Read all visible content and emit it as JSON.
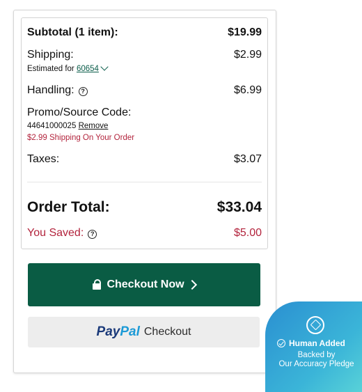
{
  "summary": {
    "subtotal_label": "Subtotal (1 item):",
    "subtotal_value": "$19.99",
    "shipping_label": "Shipping:",
    "shipping_value": "$2.99",
    "estimated_for_label": "Estimated for",
    "zip": "60654",
    "handling_label": "Handling:",
    "handling_value": "$6.99",
    "promo_label": "Promo/Source Code:",
    "promo_code": "44641000025",
    "promo_remove": "Remove",
    "promo_message": "$2.99 Shipping On Your Order",
    "taxes_label": "Taxes:",
    "taxes_value": "$3.07",
    "order_total_label": "Order Total:",
    "order_total_value": "$33.04",
    "saved_label": "You Saved:",
    "saved_value": "$5.00",
    "help_glyph": "?"
  },
  "checkout": {
    "label": "Checkout Now"
  },
  "paypal": {
    "brand_part1": "Pay",
    "brand_part2": "Pal",
    "label": "Checkout"
  },
  "badge": {
    "title": "Human Added",
    "line1": "Backed by",
    "line2": "Our Accuracy Pledge"
  },
  "colors": {
    "accent": "#0a5c44",
    "sale": "#b3243d",
    "paypal_dark": "#1b3a7a",
    "paypal_light": "#1c9ad6"
  }
}
